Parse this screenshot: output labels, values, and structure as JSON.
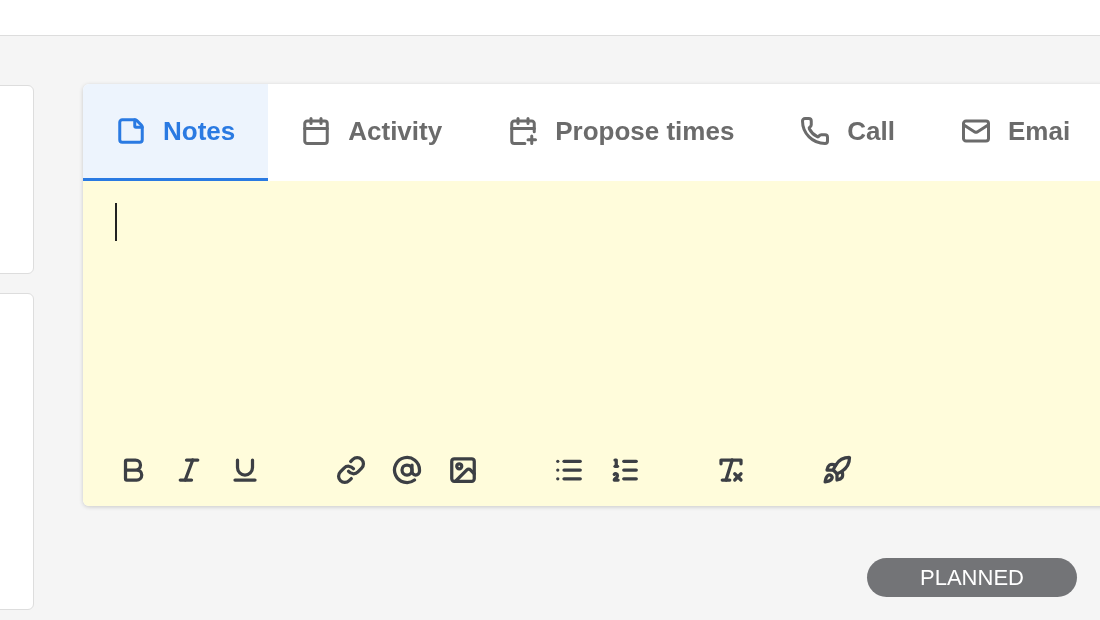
{
  "tabs": [
    {
      "label": "Notes",
      "kind": "notes",
      "selected": true
    },
    {
      "label": "Activity",
      "kind": "activity",
      "selected": false
    },
    {
      "label": "Propose times",
      "kind": "propose",
      "selected": false
    },
    {
      "label": "Call",
      "kind": "call",
      "selected": false
    },
    {
      "label": "Emai",
      "kind": "email",
      "selected": false
    }
  ],
  "status_badge": "PLANNED"
}
